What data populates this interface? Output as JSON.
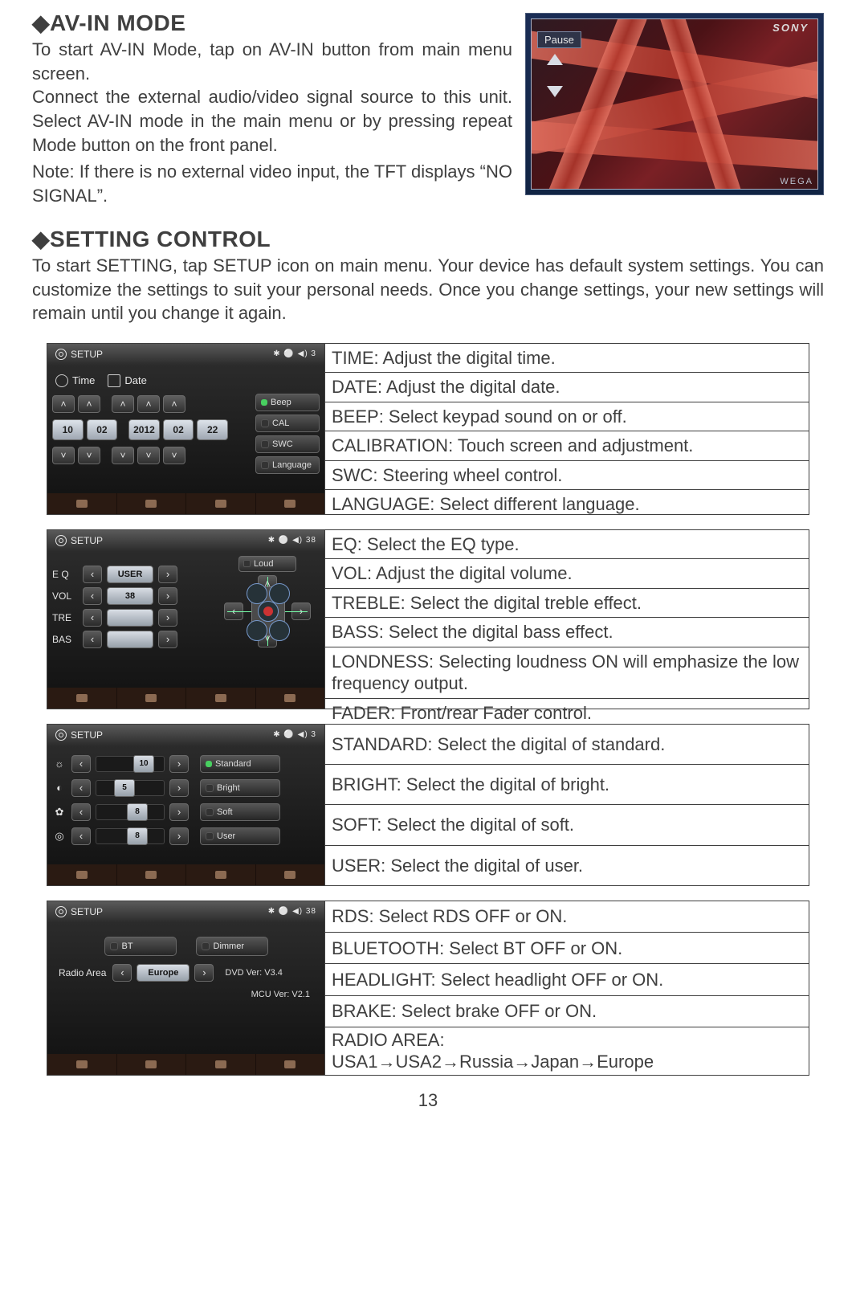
{
  "avin": {
    "title": "◆AV-IN MODE",
    "p1": "To start AV-IN Mode, tap on AV-IN button from main menu screen.",
    "p2": "Connect the external audio/video signal source to this unit. Select AV-IN mode in the main menu or by pressing repeat Mode button on the front panel.",
    "p3": "Note: If there is no external video input, the TFT displays “NO SIGNAL”.",
    "photo": {
      "brand": "SONY",
      "state": "Pause",
      "badge": "WEGA"
    }
  },
  "setting": {
    "title": "◆SETTING CONTROL",
    "intro": "To start SETTING, tap SETUP icon on main menu. Your device has default system settings. You can customize the settings to suit your personal needs. Once you change settings, your new settings will remain until you change it again."
  },
  "setup_label": "SETUP",
  "status1": "✱ ⚪ ◀) 3",
  "status2": "✱ ⚪ ◀) 38",
  "status3": "✱ ⚪ ◀) 3",
  "status4": "✱ ⚪ ◀) 38",
  "block1": {
    "tabs": {
      "time": "Time",
      "date": "Date"
    },
    "time": [
      "10",
      "02"
    ],
    "date": [
      "2012",
      "02",
      "22"
    ],
    "side": [
      "Beep",
      "CAL",
      "SWC",
      "Language"
    ],
    "rows": [
      "TIME: Adjust the digital time.",
      "DATE: Adjust the digital date.",
      "BEEP: Select keypad sound on or off.",
      "CALIBRATION: Touch screen and adjustment.",
      "SWC: Steering wheel control.",
      "LANGUAGE: Select different language."
    ]
  },
  "block2": {
    "labels": {
      "eq": "E Q",
      "vol": "VOL",
      "tre": "TRE",
      "bas": "BAS"
    },
    "eq_val": "USER",
    "vol_val": "38",
    "loud": "Loud",
    "rows": [
      "EQ: Select the EQ type.",
      "VOL: Adjust the digital volume.",
      "TREBLE: Select the digital treble effect.",
      "BASS: Select the digital bass effect.",
      "LONDNESS: Selecting loudness ON will emphasize the low frequency output.",
      "FADER: Front/rear Fader control."
    ]
  },
  "block3": {
    "sliders": [
      {
        "icon": "☼",
        "val": "10",
        "mode": "Standard",
        "active": true
      },
      {
        "icon": "◐",
        "val": "5",
        "mode": "Bright",
        "active": false
      },
      {
        "icon": "✿",
        "val": "8",
        "mode": "Soft",
        "active": false
      },
      {
        "icon": "◎",
        "val": "8",
        "mode": "User",
        "active": false
      }
    ],
    "rows": [
      "STANDARD: Select the digital of standard.",
      "BRIGHT: Select the digital of bright.",
      "SOFT: Select the digital of soft.",
      "USER: Select the digital of user."
    ]
  },
  "block4": {
    "bt": "BT",
    "dimmer": "Dimmer",
    "radio_area_lbl": "Radio Area",
    "radio_area_val": "Europe",
    "dvd_ver": "DVD Ver: V3.4",
    "mcu_ver": "MCU Ver: V2.1",
    "rows": [
      "RDS: Select RDS OFF or ON.",
      "BLUETOOTH: Select BT OFF or ON.",
      "HEADLIGHT: Select headlight OFF or ON.",
      "BRAKE: Select brake OFF or ON."
    ],
    "row5a": "RADIO AREA:",
    "row5b": "USA1→USA2→Russia→Japan→Europe"
  },
  "pagenum": "13"
}
